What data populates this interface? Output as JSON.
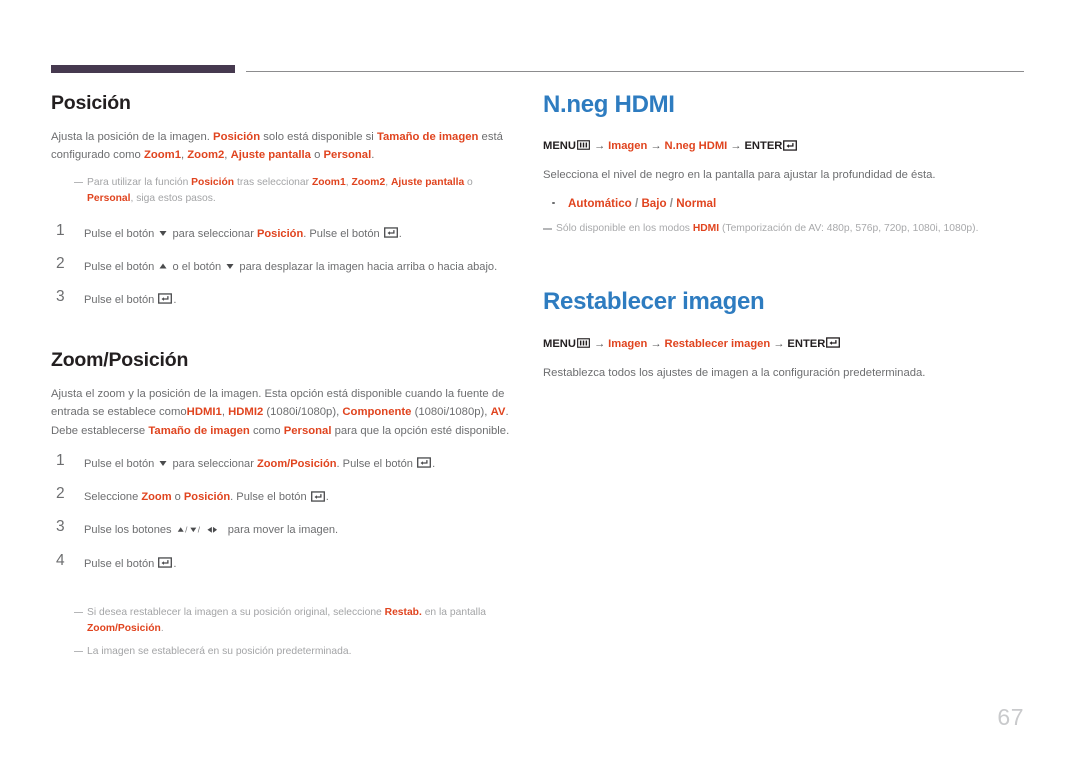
{
  "document": {
    "page_number": "67",
    "accent_orange": "#e0441f",
    "accent_blue": "#2e7cc0",
    "rule_purple": "#46394f",
    "body_gray": "#6d6e70"
  },
  "left_column": {
    "section1": {
      "title": "Posición",
      "intro": {
        "p1": "Ajusta la posición de la imagen. ",
        "t1": "Posición",
        "p2": " solo está disponible si ",
        "t2": "Tamaño de imagen",
        "p3": " está configurado como ",
        "t3": "Zoom1",
        "p4": ", ",
        "t4": "Zoom2",
        "p5": ", ",
        "t5": "Ajuste pantalla",
        "p6": " o ",
        "t6": "Personal",
        "p7": "."
      },
      "note": {
        "n1": "Para utilizar la función ",
        "t1": "Posición",
        "n2": " tras seleccionar ",
        "t2": "Zoom1",
        "n3": ", ",
        "t3": "Zoom2",
        "n4": ", ",
        "t4": "Ajuste pantalla",
        "n5": " o ",
        "t5": "Personal",
        "n6": ", siga estos pasos."
      },
      "steps": [
        {
          "num": "1",
          "a": "Pulse el botón ",
          "icon1": "arrow-down-icon",
          "b": " para seleccionar ",
          "hl": "Posición",
          "c": ". Pulse el botón ",
          "icon2": "enter-icon",
          "d": "."
        },
        {
          "num": "2",
          "a": "Pulse el botón ",
          "icon1": "arrow-up-icon",
          "b": " o el botón ",
          "icon2": "arrow-down-icon",
          "c": " para desplazar la imagen hacia arriba o hacia abajo."
        },
        {
          "num": "3",
          "a": "Pulse el botón ",
          "icon1": "enter-icon",
          "b": "."
        }
      ]
    },
    "section2": {
      "title": "Zoom/Posición",
      "intro": {
        "p1": "Ajusta el zoom y la posición de la imagen. Esta opción está disponible cuando la fuente de entrada se establece como",
        "t1": "HDMI1",
        "p2": ", ",
        "t2": "HDMI2",
        "p3": " (1080i/1080p), ",
        "t3": "Componente",
        "p4": " (1080i/1080p), ",
        "t4": "AV",
        "p5": ". Debe establecerse ",
        "t5": "Tamaño de imagen",
        "p6": " como ",
        "t6": "Personal",
        "p7": " para que la opción esté disponible."
      },
      "steps": [
        {
          "num": "1",
          "a": "Pulse el botón ",
          "icon1": "arrow-down-icon",
          "b": " para seleccionar ",
          "hl": "Zoom/Posición",
          "c": ". Pulse el botón ",
          "icon2": "enter-icon",
          "d": "."
        },
        {
          "num": "2",
          "a": "Seleccione ",
          "hl1": "Zoom",
          "b": " o ",
          "hl2": "Posición",
          "c": ". Pulse el botón ",
          "icon2": "enter-icon",
          "d": "."
        },
        {
          "num": "3",
          "a": "Pulse los botones ",
          "icon1": "arrow-cluster-icon",
          "b": " para mover la imagen."
        },
        {
          "num": "4",
          "a": "Pulse el botón ",
          "icon1": "enter-icon",
          "b": "."
        }
      ],
      "note1": {
        "n1": "Si desea restablecer la imagen a su posición original, seleccione ",
        "t1": "Restab.",
        "n2": " en la pantalla ",
        "t2": "Zoom/Posición",
        "n3": "."
      },
      "note2": {
        "n1": "La imagen se establecerá en su posición predeterminada."
      }
    }
  },
  "right_column": {
    "section1": {
      "title": "N.neg HDMI",
      "menupath": {
        "menu_label": "MENU",
        "menu_icon": "menu-grid-icon",
        "arrow": "→",
        "item1": "Imagen",
        "item2": "N.neg HDMI",
        "enter_label": "ENTER",
        "enter_icon": "enter-icon"
      },
      "description": "Selecciona el nivel de negro en la pantalla para ajustar la profundidad de ésta.",
      "options": {
        "o1": "Automático",
        "sep1": " / ",
        "o2": "Bajo",
        "sep2": " / ",
        "o3": "Normal"
      },
      "note": {
        "n1": "Sólo disponible en los modos ",
        "t1": "HDMI",
        "n2": " (Temporización de AV: 480p, 576p, 720p, 1080i, 1080p)."
      }
    },
    "section2": {
      "title": "Restablecer imagen",
      "menupath": {
        "menu_label": "MENU",
        "menu_icon": "menu-grid-icon",
        "arrow": "→",
        "item1": "Imagen",
        "item2": "Restablecer imagen",
        "enter_label": "ENTER",
        "enter_icon": "enter-icon"
      },
      "description": "Restablezca todos los ajustes de imagen a la configuración predeterminada."
    }
  }
}
